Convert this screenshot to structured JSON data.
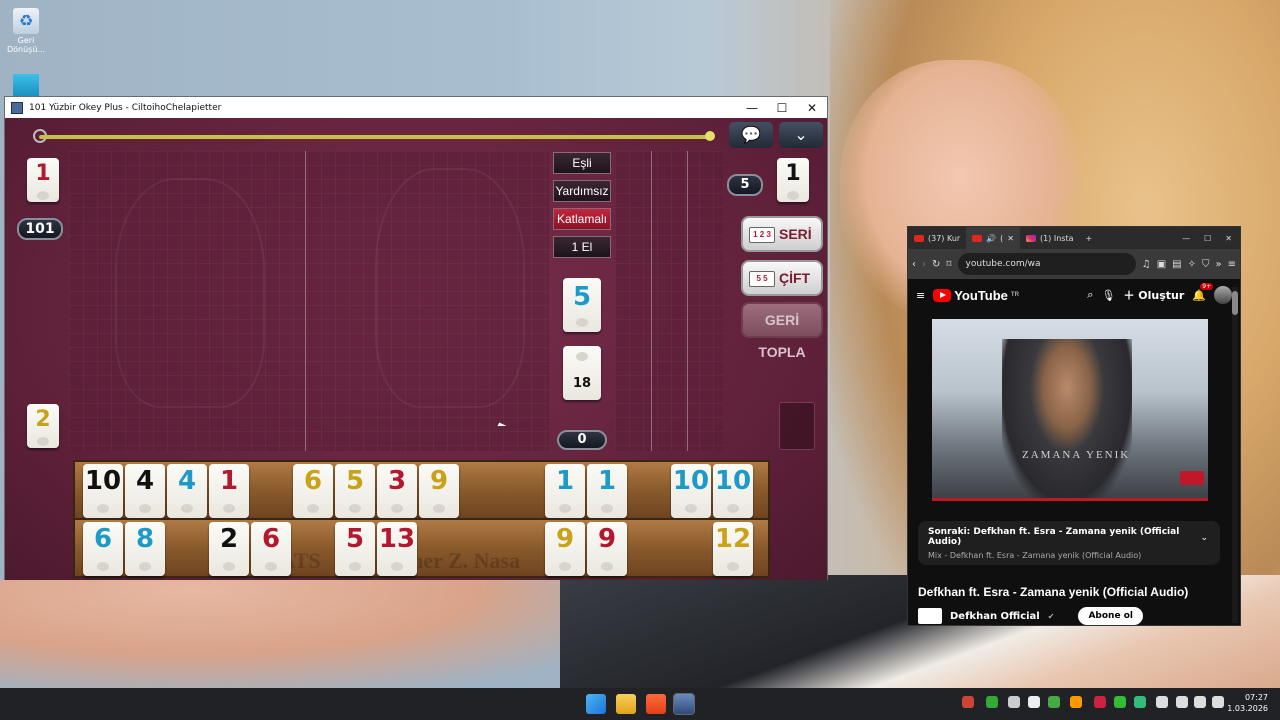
{
  "desktop": {
    "recycle_label": "Geri Dönüşü...",
    "icon2_label": ""
  },
  "game": {
    "title": "101 Yüzbir Okey Plus - CiltoihoChelapietter",
    "controls": {
      "min": "—",
      "max": "☐",
      "close": "✕"
    },
    "left_tile_top": "1",
    "left_score": "101",
    "left_tile_bottom": "2",
    "right_tile_top": "1",
    "right_badge": "5",
    "options": [
      "Eşli",
      "Yardımsız",
      "Katlamalı",
      "1 El"
    ],
    "selected_option": "Katlamalı",
    "indicator_tile": "5",
    "pile_count": "18",
    "center_counter": "0",
    "btn_seri": "SERİ AÇ",
    "btn_cift": "ÇİFT AÇ",
    "btn_geri": "GERİ TOPLA",
    "mini_seri": "1 2 3",
    "mini_cift": "5 5",
    "rack_watermark": "IATS",
    "rack_watermark2": "mer Z. Nasa",
    "rack_row1": [
      {
        "n": "10",
        "c": "blk"
      },
      {
        "n": "4",
        "c": "blk"
      },
      {
        "n": "4",
        "c": "blu"
      },
      {
        "n": "1",
        "c": "red"
      },
      {
        "n": "6",
        "c": "yel"
      },
      {
        "n": "5",
        "c": "yel"
      },
      {
        "n": "3",
        "c": "red"
      },
      {
        "n": "9",
        "c": "yel"
      },
      {
        "n": "1",
        "c": "blu"
      },
      {
        "n": "1",
        "c": "blu"
      },
      {
        "n": "10",
        "c": "blu"
      },
      {
        "n": "10",
        "c": "blu"
      }
    ],
    "rack_row2": [
      {
        "n": "6",
        "c": "blu"
      },
      {
        "n": "8",
        "c": "blu"
      },
      {
        "n": "2",
        "c": "blk"
      },
      {
        "n": "6",
        "c": "red"
      },
      {
        "n": "5",
        "c": "red"
      },
      {
        "n": "13",
        "c": "red"
      },
      {
        "n": "9",
        "c": "yel"
      },
      {
        "n": "9",
        "c": "red"
      },
      {
        "n": "12",
        "c": "yel"
      }
    ]
  },
  "browser": {
    "tab1": "(37) Kur",
    "tab2": "(",
    "tab3": "(1) Insta",
    "new_tab": "+",
    "controls": {
      "min": "—",
      "max": "☐",
      "close": "✕"
    },
    "url": "youtube.com/wa",
    "yt_logo": "YouTube",
    "yt_region": "TR",
    "create_label": "Oluştur",
    "notif_badge": "9+",
    "video_watermark": "ZAMANA YENIK",
    "upnext_title": "Sonraki: Defkhan ft. Esra - Zamana yenik (Official Audio)",
    "upnext_sub": "Mix - Defkhan ft. Esra - Zamana yenik (Official Audio)",
    "video_title": "Defkhan ft. Esra - Zamana yenik (Official Audio)",
    "channel": "Defkhan Official",
    "subscribe": "Abone ol"
  },
  "taskbar": {
    "time": "07:27",
    "date": "1.03.2026"
  },
  "colors": {
    "board": "#5e2039",
    "accent_red": "#b3182e",
    "tile_blue": "#1e9ac8",
    "tile_yellow": "#c9a21a",
    "yt_red": "#ff0000"
  }
}
